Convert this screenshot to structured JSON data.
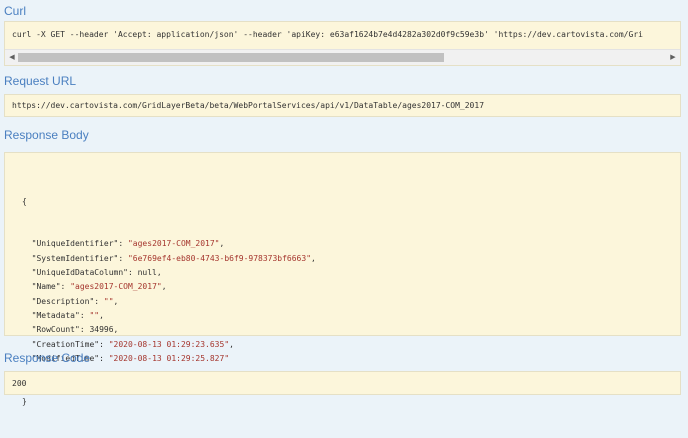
{
  "curl": {
    "heading": "Curl",
    "command": "curl -X GET --header 'Accept: application/json' --header 'apiKey: e63af1624b7e4d4282a302d0f9c59e3b' 'https://dev.cartovista.com/Gri"
  },
  "request_url": {
    "heading": "Request URL",
    "value": "https://dev.cartovista.com/GridLayerBeta/beta/WebPortalServices/api/v1/DataTable/ages2017-COM_2017"
  },
  "response_body": {
    "heading": "Response Body",
    "open_brace": "{",
    "close_brace": "}",
    "fields": [
      {
        "key": "\"UniqueIdentifier\"",
        "value": "\"ages2017-COM_2017\"",
        "type": "string",
        "sep": ","
      },
      {
        "key": "\"SystemIdentifier\"",
        "value": "\"6e769ef4-eb80-4743-b6f9-978373bf6663\"",
        "type": "string",
        "sep": ","
      },
      {
        "key": "\"UniqueIdDataColumn\"",
        "value": "null",
        "type": "plain",
        "sep": ","
      },
      {
        "key": "\"Name\"",
        "value": "\"ages2017-COM_2017\"",
        "type": "string",
        "sep": ","
      },
      {
        "key": "\"Description\"",
        "value": "\"\"",
        "type": "string",
        "sep": ","
      },
      {
        "key": "\"Metadata\"",
        "value": "\"\"",
        "type": "string",
        "sep": ","
      },
      {
        "key": "\"RowCount\"",
        "value": "34996",
        "type": "plain",
        "sep": ","
      },
      {
        "key": "\"CreationTime\"",
        "value": "\"2020-08-13 01:29:23.635\"",
        "type": "string",
        "sep": ","
      },
      {
        "key": "\"ModifiedTime\"",
        "value": "\"2020-08-13 01:29:25.827\"",
        "type": "string",
        "sep": ""
      }
    ]
  },
  "response_code": {
    "heading": "Response Code",
    "value": "200"
  },
  "icons": {
    "scroll_left": "scroll-left-arrow-icon",
    "scroll_right": "scroll-right-arrow-icon"
  },
  "colors": {
    "background": "#ebf3f9",
    "heading": "#4a7fc0",
    "box": "#fcf6db",
    "string": "#a5362e"
  }
}
